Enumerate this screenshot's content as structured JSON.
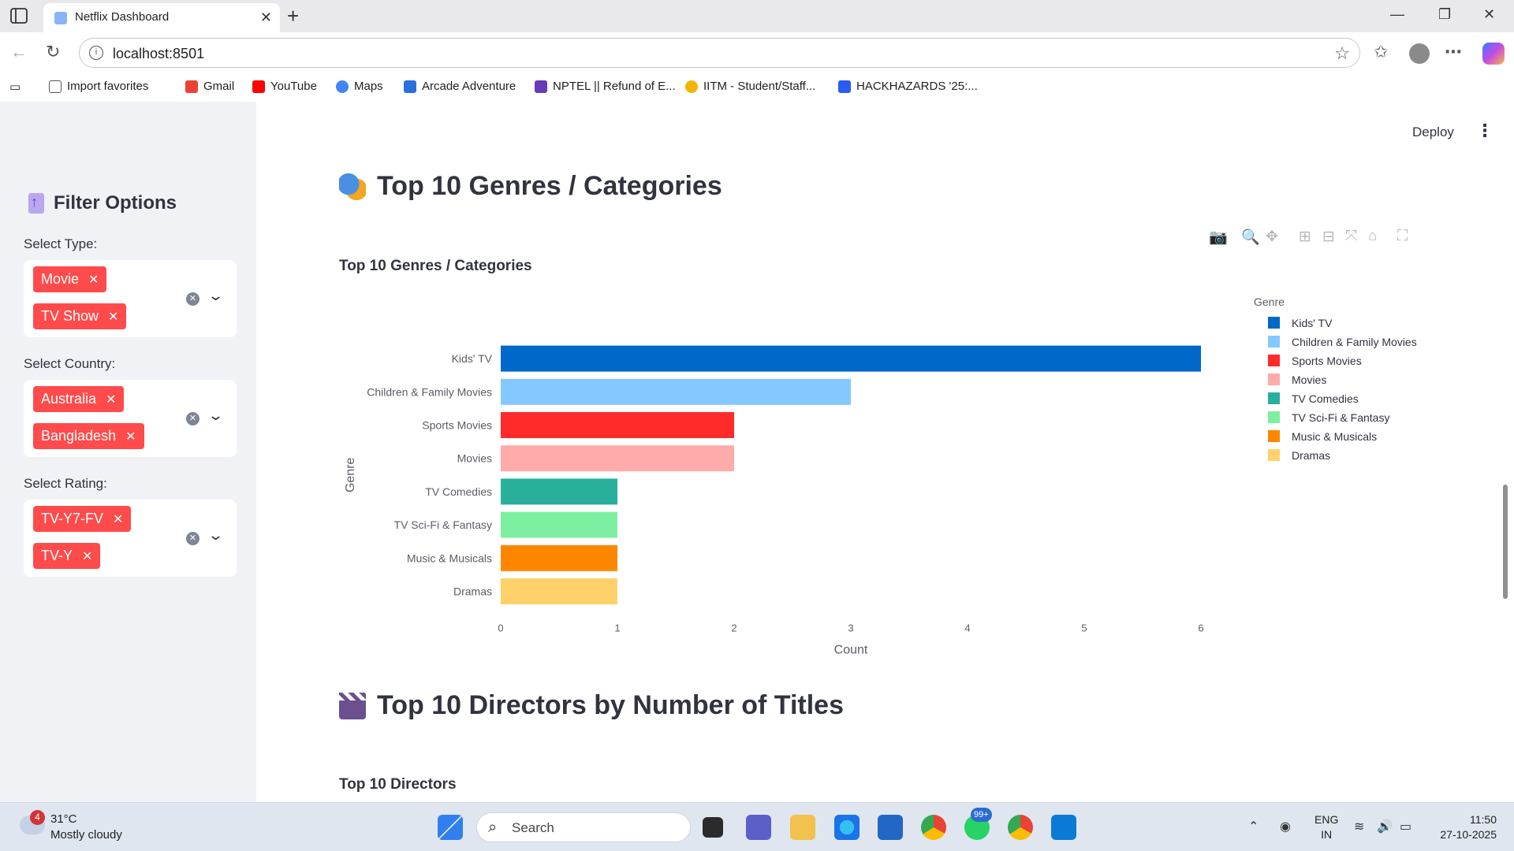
{
  "browser": {
    "tab_title": "Netflix Dashboard",
    "url": "localhost:8501",
    "bookmarks": [
      {
        "label": "Import favorites",
        "icon": "import-icon",
        "color": "#555555"
      },
      {
        "label": "Gmail",
        "icon": "gmail-icon",
        "color": "#ea4335"
      },
      {
        "label": "YouTube",
        "icon": "youtube-icon",
        "color": "#ff0000"
      },
      {
        "label": "Maps",
        "icon": "google-icon",
        "color": "#4285f4"
      },
      {
        "label": "Arcade Adventure",
        "icon": "arcade-icon",
        "color": "#2a6fdb"
      },
      {
        "label": "NPTEL || Refund of E...",
        "icon": "form-icon",
        "color": "#673ab7"
      },
      {
        "label": "IITM - Student/Staff...",
        "icon": "emoji-icon",
        "color": "#f5b301"
      },
      {
        "label": "HACKHAZARDS '25:...",
        "icon": "hackhazards-icon",
        "color": "#2b5cf0"
      }
    ]
  },
  "app": {
    "deploy_label": "Deploy",
    "sidebar": {
      "title": "Filter Options",
      "filters": [
        {
          "label": "Select Type:",
          "chips": [
            "Movie",
            "TV Show"
          ]
        },
        {
          "label": "Select Country:",
          "chips": [
            "Australia",
            "Bangladesh"
          ]
        },
        {
          "label": "Select Rating:",
          "chips": [
            "TV-Y7-FV",
            "TV-Y"
          ]
        }
      ]
    },
    "section1": {
      "heading": "Top 10 Genres / Categories",
      "icon": "performing-arts-icon"
    },
    "section2": {
      "heading": "Top 10 Directors by Number of Titles",
      "icon": "clapper-board-icon",
      "chart_title": "Top 10 Directors"
    }
  },
  "chart_data": {
    "type": "bar",
    "orientation": "horizontal",
    "title": "Top 10 Genres / Categories",
    "xlabel": "Count",
    "ylabel": "Genre",
    "legend_title": "Genre",
    "legend_position": "right",
    "xlim": [
      0,
      6
    ],
    "xticks": [
      0,
      1,
      2,
      3,
      4,
      5,
      6
    ],
    "categories": [
      "Kids' TV",
      "Children & Family Movies",
      "Sports Movies",
      "Movies",
      "TV Comedies",
      "TV Sci-Fi & Fantasy",
      "Music & Musicals",
      "Dramas"
    ],
    "values": [
      6,
      3,
      2,
      2,
      1,
      1,
      1,
      1
    ],
    "colors": [
      "#0068c9",
      "#83c9ff",
      "#ff2b2b",
      "#ffabab",
      "#29b09d",
      "#7defa1",
      "#ff8700",
      "#ffd16a"
    ]
  },
  "taskbar": {
    "weather_temp": "31°C",
    "weather_desc": "Mostly cloudy",
    "weather_badge": "4",
    "search_placeholder": "Search",
    "whatsapp_badge": "99+",
    "lang_1": "ENG",
    "lang_2": "IN",
    "time": "11:50",
    "date": "27-10-2025"
  }
}
